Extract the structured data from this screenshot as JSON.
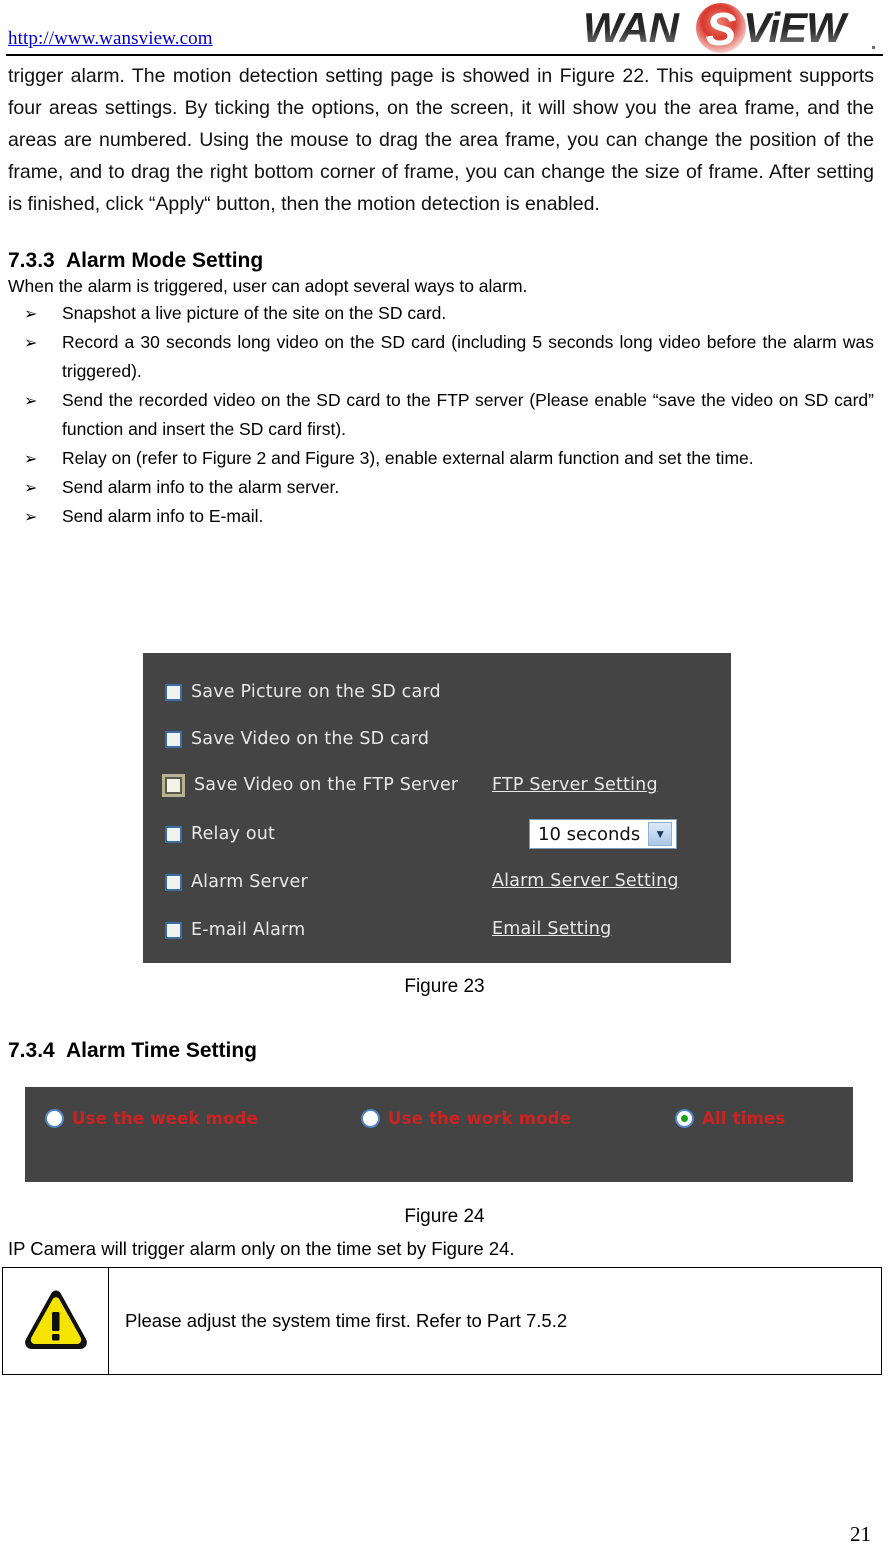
{
  "header": {
    "site_url": "http://www.wansview.com",
    "logo_text": "WANSVIEW",
    "logo_part1": "WAN",
    "logo_part2": "S",
    "logo_part3": "ViEW",
    "logo_accent_color": "#d13a2e"
  },
  "body": {
    "intro_paragraph": "trigger alarm. The motion detection setting page is showed in Figure 22. This equipment supports four areas settings. By ticking the options, on the screen, it will show you the area frame, and the areas are numbered. Using the mouse to drag the area frame, you can change the position of the frame, and to drag the right bottom corner of frame, you can change the size of frame. After setting is finished, click “Apply“ button, then the motion detection is enabled."
  },
  "section_733": {
    "number": "7.3.3",
    "title": "Alarm Mode Setting",
    "lead": "When the alarm is triggered, user can adopt several ways to alarm.",
    "bullet_glyph": "➢",
    "bullets": [
      "Snapshot a live picture of the site on the SD card.",
      "Record a 30 seconds long video on the SD card (including 5 seconds long video before the alarm was triggered).",
      "Send the recorded video on the SD card to the FTP server (Please enable “save the video on SD card” function and insert the SD card first).",
      "Relay on (refer to Figure 2 and Figure 3), enable external alarm function and set the time.",
      "Send alarm info to the alarm server.",
      "Send alarm info to E-mail."
    ]
  },
  "figure23": {
    "caption": "Figure 23",
    "panel_bg": "#444444",
    "checkboxes": [
      {
        "label": "Save Picture on the SD card",
        "checked": false,
        "focused": false
      },
      {
        "label": "Save Video on the SD card",
        "checked": false,
        "focused": false
      },
      {
        "label": "Save Video on the FTP Server",
        "checked": false,
        "focused": true
      },
      {
        "label": "Relay out",
        "checked": false,
        "focused": false
      },
      {
        "label": "Alarm Server",
        "checked": false,
        "focused": false
      },
      {
        "label": "E-mail Alarm",
        "checked": false,
        "focused": false
      }
    ],
    "links": [
      "FTP Server Setting",
      "Alarm Server Setting",
      "Email Setting"
    ],
    "relay_duration_select": {
      "value": "10 seconds",
      "arrow": "▼"
    }
  },
  "section_734": {
    "number": "7.3.4",
    "title": "Alarm Time Setting"
  },
  "figure24": {
    "caption": "Figure 24",
    "panel_bg": "#444444",
    "label_color": "#cc2222",
    "radios": [
      {
        "label": "Use the week mode",
        "checked": false
      },
      {
        "label": "Use the work mode",
        "checked": false
      },
      {
        "label": "All times",
        "checked": true
      }
    ]
  },
  "after_figure24": {
    "text": "IP Camera will trigger alarm only on the time set by Figure 24."
  },
  "note": {
    "icon": "warning-triangle-icon",
    "text": "Please adjust the system time first. Refer to Part 7.5.2"
  },
  "footer": {
    "page_number": "21"
  }
}
